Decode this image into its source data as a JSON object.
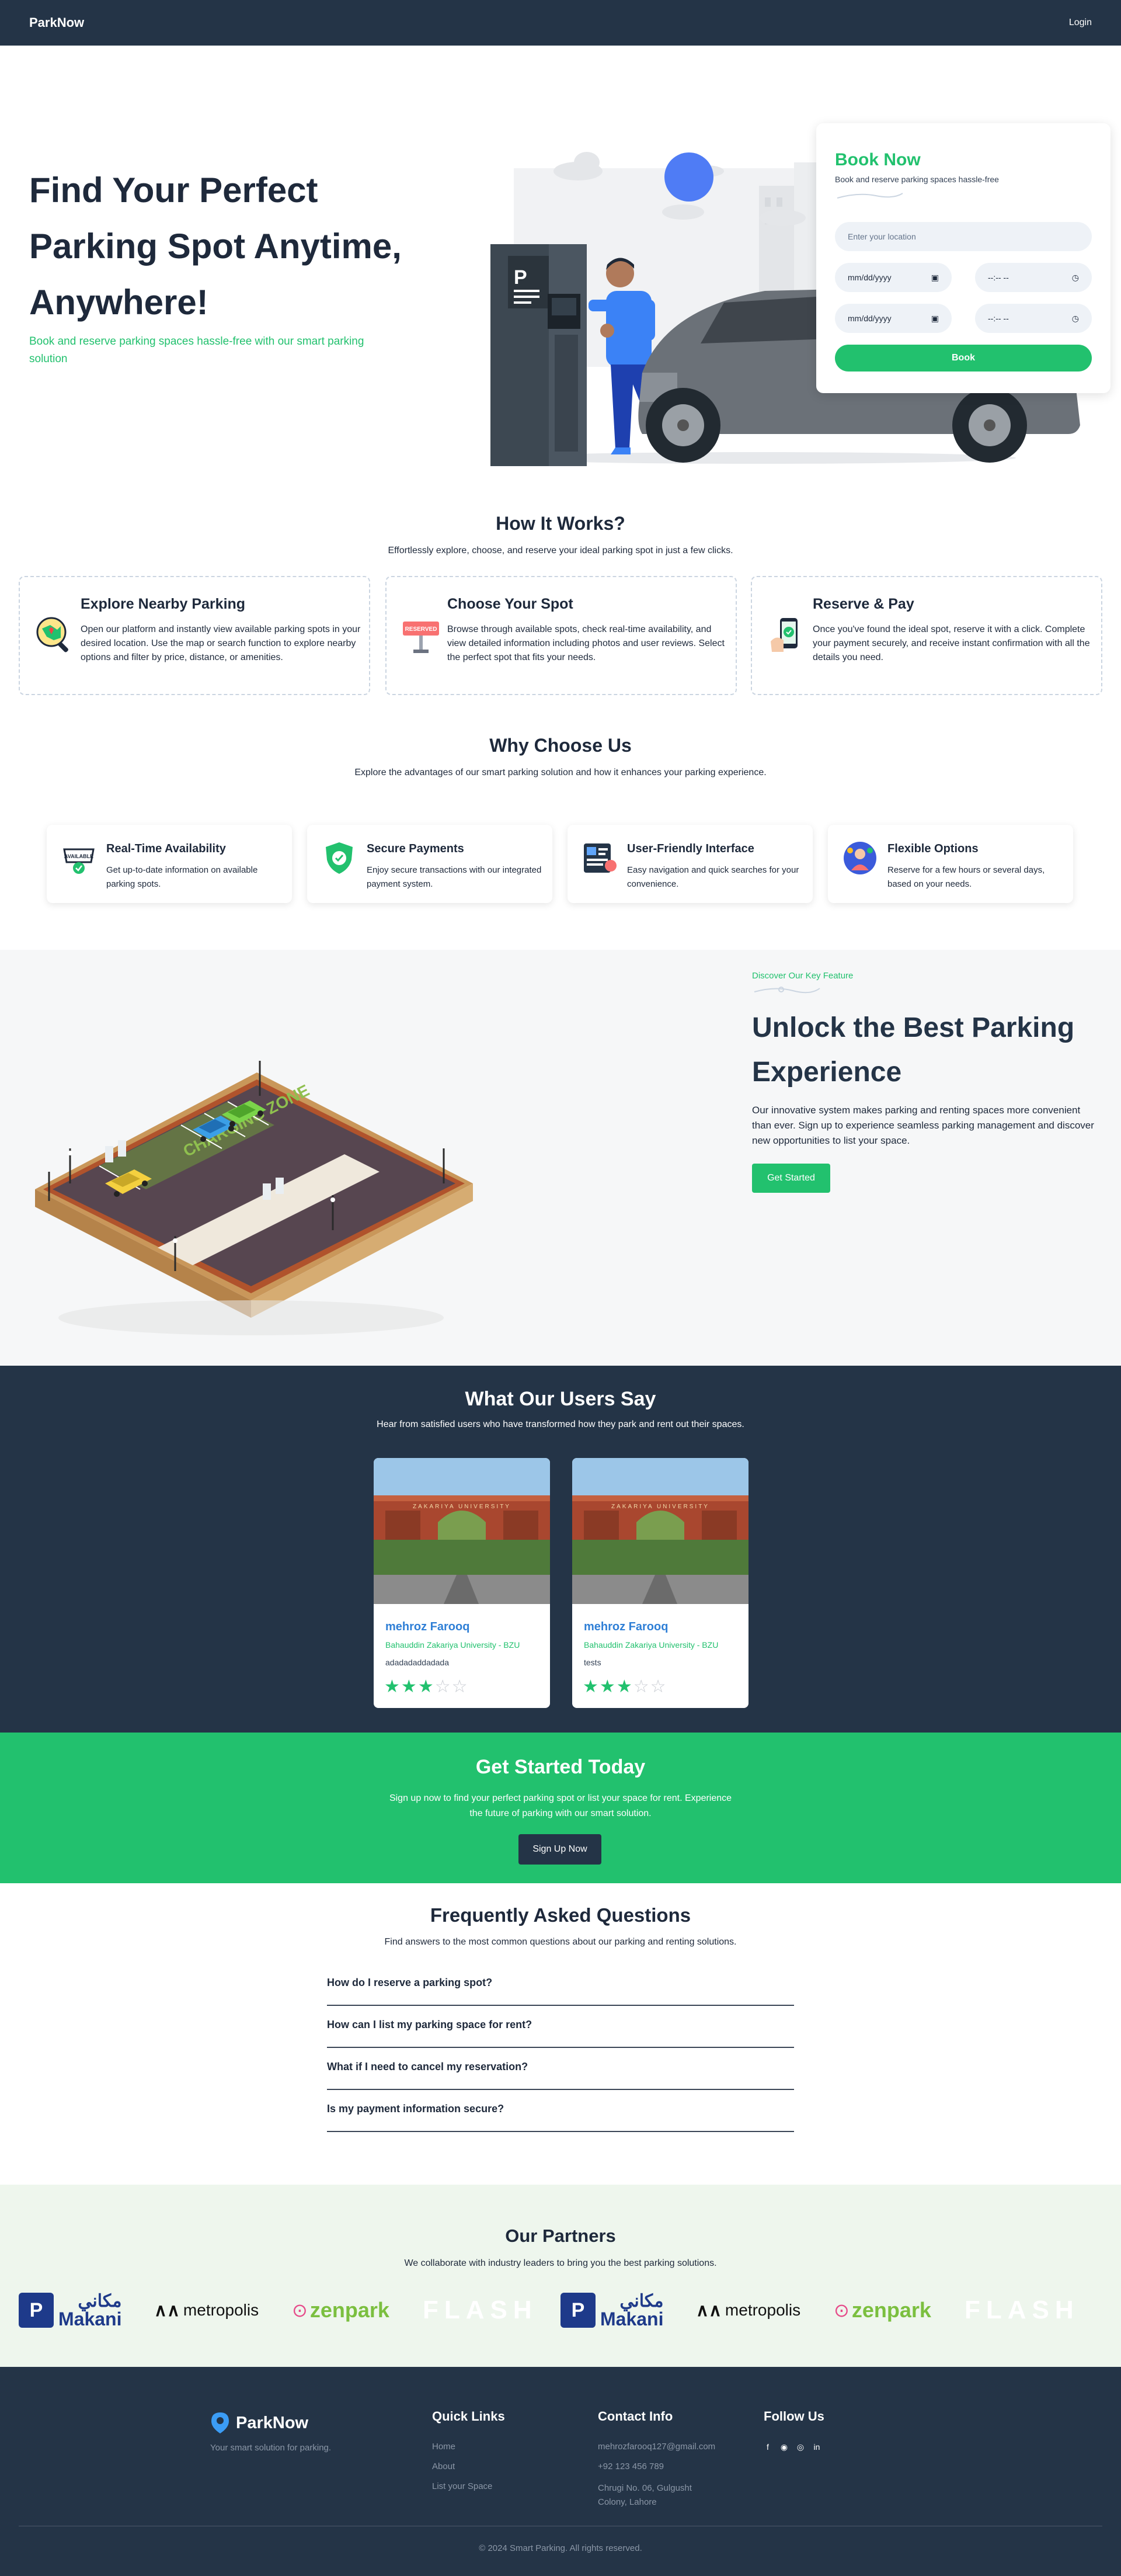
{
  "nav": {
    "brand": "ParkNow",
    "login": "Login"
  },
  "hero": {
    "title": "Find Your Perfect Parking Spot Anytime, Anywhere!",
    "subtitle": "Book and reserve parking spaces hassle-free with our smart parking solution"
  },
  "booking": {
    "title": "Book Now",
    "subtitle": "Book and reserve parking spaces hassle-free",
    "location_placeholder": "Enter your location",
    "date_placeholder": "mm/dd/yyyy",
    "time_placeholder": "--:-- --",
    "button": "Book"
  },
  "how": {
    "title": "How It Works?",
    "subtitle": "Effortlessly explore, choose, and reserve your ideal parking spot in just a few clicks.",
    "cards": [
      {
        "title": "Explore Nearby Parking",
        "text": "Open our platform and instantly view available parking spots in your desired location. Use the map or search function to explore nearby options and filter by price, distance, or amenities.",
        "icon": "map-search-icon"
      },
      {
        "title": "Choose Your Spot",
        "text": "Browse through available spots, check real-time availability, and view detailed information including photos and user reviews. Select the perfect spot that fits your needs.",
        "icon": "reserved-sign-icon"
      },
      {
        "title": "Reserve & Pay",
        "text": "Once you've found the ideal spot, reserve it with a click. Complete your payment securely, and receive instant confirmation with all the details you need.",
        "icon": "phone-payment-icon"
      }
    ]
  },
  "why": {
    "title": "Why Choose Us",
    "subtitle": "Explore the advantages of our smart parking solution and how it enhances your parking experience.",
    "cards": [
      {
        "title": "Real-Time Availability",
        "text": "Get up-to-date information on available parking spots.",
        "icon": "available-sign-icon",
        "badge": "AVAILABLE"
      },
      {
        "title": "Secure Payments",
        "text": "Enjoy secure transactions with our integrated payment system.",
        "icon": "shield-check-icon"
      },
      {
        "title": "User-Friendly Interface",
        "text": "Easy navigation and quick searches for your convenience.",
        "icon": "interface-icon"
      },
      {
        "title": "Flexible Options",
        "text": "Reserve for a few hours or several days, based on your needs.",
        "icon": "flexible-options-icon"
      }
    ]
  },
  "feature": {
    "tag": "Discover Our Key Feature",
    "title": "Unlock the Best Parking Experience",
    "text": "Our innovative system makes parking and renting spaces more convenient than ever. Sign up to experience seamless parking management and discover new opportunities to list your space.",
    "button": "Get Started",
    "illustration_label": "CHARGING ZONE"
  },
  "testimonials": {
    "title": "What Our Users Say",
    "subtitle": "Hear from satisfied users who have transformed how they park and rent out their spaces.",
    "items": [
      {
        "name": "mehroz Farooq",
        "university": "Bahauddin Zakariya University - BZU",
        "message": "adadadaddadada",
        "rating": 3,
        "max": 5
      },
      {
        "name": "mehroz Farooq",
        "university": "Bahauddin Zakariya University - BZU",
        "message": "tests",
        "rating": 3,
        "max": 5
      }
    ]
  },
  "cta": {
    "title": "Get Started Today",
    "text": "Sign up now to find your perfect parking spot or list your space for rent. Experience the future of parking with our smart solution.",
    "button": "Sign Up Now"
  },
  "faq": {
    "title": "Frequently Asked Questions",
    "subtitle": "Find answers to the most common questions about our parking and renting solutions.",
    "questions": [
      "How do I reserve a parking spot?",
      "How can I list my parking space for rent?",
      "What if I need to cancel my reservation?",
      "Is my payment information secure?"
    ]
  },
  "partners": {
    "title": "Our Partners",
    "subtitle": "We collaborate with industry leaders to bring you the best parking solutions.",
    "logos": [
      "Makani",
      "metropolis",
      "zenpark",
      "FLASH",
      "Makani",
      "metropolis",
      "zenpark",
      "FLASH"
    ],
    "makani_arabic": "مكاني"
  },
  "footer": {
    "brand": "ParkNow",
    "tagline": "Your smart solution for parking.",
    "quick_title": "Quick Links",
    "links": [
      "Home",
      "About",
      "List your Space"
    ],
    "contact_title": "Contact Info",
    "email": "mehrozfarooq127@gmail.com",
    "phone": "+92 123 456 789",
    "address": "Chrugi No. 06, Gulgusht Colony, Lahore",
    "follow_title": "Follow Us",
    "social": [
      "f",
      "gh",
      "ig",
      "in"
    ],
    "copyright": "© 2024 Smart Parking. All rights reserved."
  },
  "colors": {
    "navy": "#243447",
    "green": "#22c16e",
    "blue": "#2f7fd6"
  }
}
